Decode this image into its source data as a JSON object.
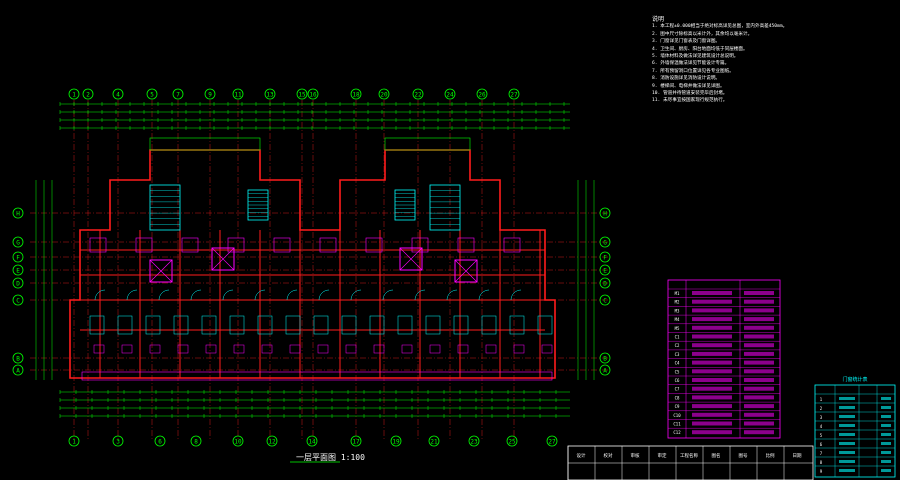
{
  "drawing": {
    "caption": "一层平面图 1:100",
    "axes_top": [
      "1",
      "2",
      "4",
      "5",
      "7",
      "9",
      "11",
      "13",
      "15",
      "16",
      "18",
      "20",
      "22",
      "24",
      "26",
      "27"
    ],
    "axes_bottom": [
      "1",
      "3",
      "6",
      "8",
      "10",
      "12",
      "14",
      "17",
      "19",
      "21",
      "23",
      "25",
      "27"
    ],
    "axes_side": [
      "H",
      "G",
      "F",
      "E",
      "D",
      "C",
      "B",
      "A"
    ]
  },
  "notes": {
    "title": "说明",
    "lines": [
      "1. 本工程±0.000相当于绝对标高详见总图，室内外高差450mm。",
      "2. 图中尺寸除标高以米计外，其余均以毫米计。",
      "3. 门窗详见门窗表及门窗详图。",
      "4. 卫生间、厨房、阳台地面均低于同层楼面。",
      "5. 墙体材料及做法详见建筑设计总说明。",
      "6. 外墙保温做法详见节能设计专篇。",
      "7. 所有预留洞口位置详见各专业图纸。",
      "8. 消防设施详见消防设计说明。",
      "9. 楼梯间、电梯井做法详见详图。",
      "10. 管道井待管道安装完毕后封堵。",
      "11. 未尽事宜按国家现行规范执行。"
    ]
  },
  "door_window_table": {
    "rows": [
      "M1",
      "M2",
      "M3",
      "M4",
      "M5",
      "C1",
      "C2",
      "C3",
      "C4",
      "C5",
      "C6",
      "C7",
      "C8",
      "C9",
      "C10",
      "C11",
      "C12"
    ]
  },
  "small_table": {
    "title": "门窗统计表",
    "rows": [
      "1",
      "2",
      "3",
      "4",
      "5",
      "6",
      "7",
      "8",
      "9"
    ]
  },
  "title_block": {
    "cells": [
      "设计",
      "校对",
      "审核",
      "审定",
      "工程名称",
      "图名",
      "图号",
      "比例",
      "日期"
    ]
  },
  "colors": {
    "wall": "#ff1c1c",
    "grid": "#00ff00",
    "notes": "#ffffff",
    "accent": "#ff00ff",
    "fixture": "#00ffff",
    "dim": "#00ff00"
  }
}
